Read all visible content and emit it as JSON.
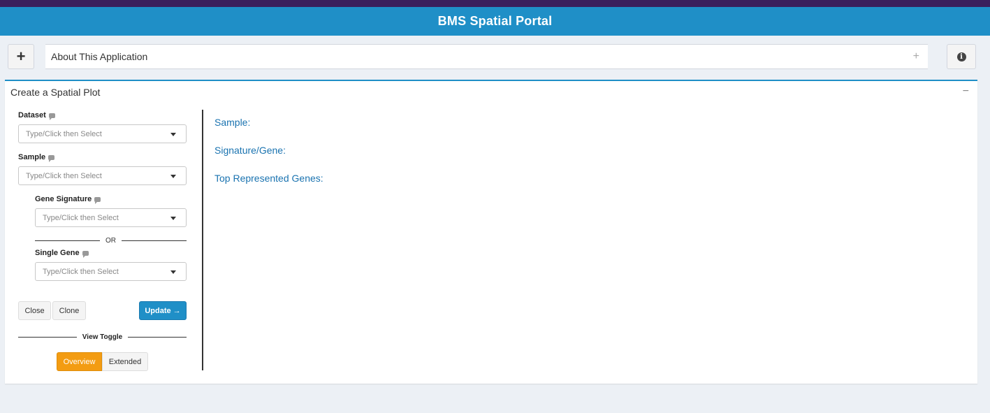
{
  "header": {
    "title": "BMS Spatial Portal"
  },
  "about": {
    "title": "About This Application",
    "expand_icon": "+"
  },
  "add_button": {
    "icon": "+"
  },
  "info_button": {
    "icon": "i"
  },
  "panel": {
    "title": "Create a Spatial Plot",
    "collapse_icon": "−",
    "fields": {
      "dataset": {
        "label": "Dataset",
        "placeholder": "Type/Click then Select"
      },
      "sample": {
        "label": "Sample",
        "placeholder": "Type/Click then Select"
      },
      "gene_signature": {
        "label": "Gene Signature",
        "placeholder": "Type/Click then Select"
      },
      "or_text": "OR",
      "single_gene": {
        "label": "Single Gene",
        "placeholder": "Type/Click then Select"
      }
    },
    "buttons": {
      "close": "Close",
      "clone": "Clone",
      "update": "Update →"
    },
    "view_toggle": {
      "label": "View Toggle",
      "options": [
        "Overview",
        "Extended"
      ],
      "selected": "Overview"
    },
    "info": {
      "sample": "Sample:",
      "signature_gene": "Signature/Gene:",
      "top_genes": "Top Represented Genes:"
    }
  },
  "colors": {
    "header": "#1f8fc7",
    "accent_orange": "#f39c12",
    "link_blue": "#1a73b0"
  }
}
